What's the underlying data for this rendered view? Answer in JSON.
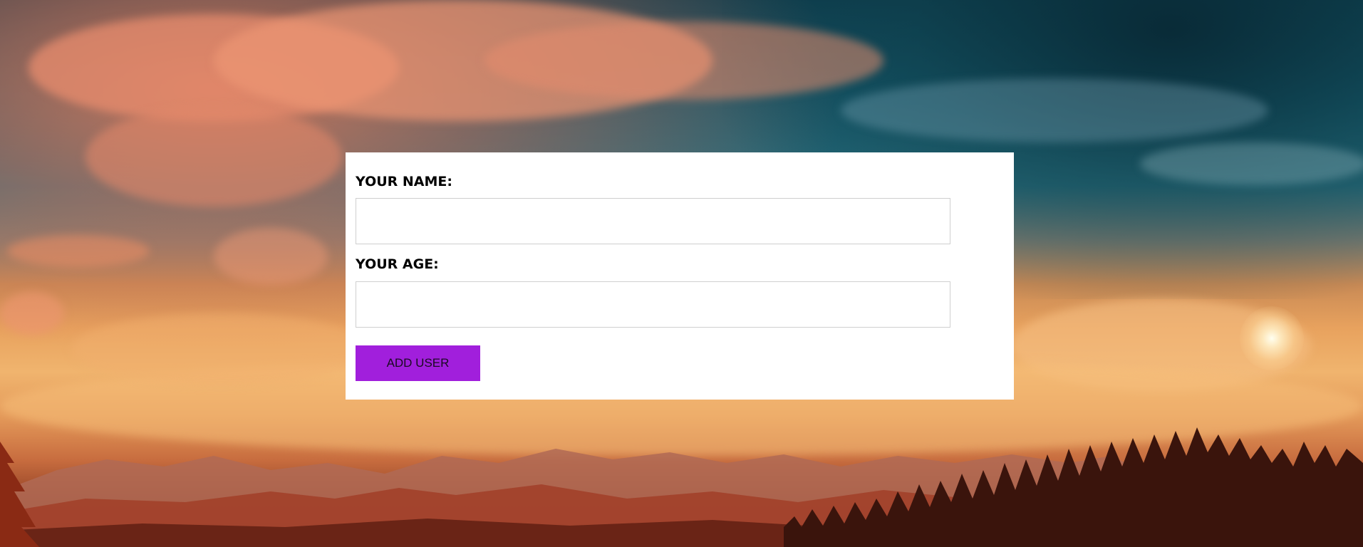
{
  "background": {
    "description_icon": "sunset-landscape-image",
    "colors": {
      "sky_top": "#0f3f4f",
      "clouds_warm": "#e8865e",
      "horizon": "#f0b46e",
      "ground": "#5b1f14"
    }
  },
  "form": {
    "name_label": "YOUR NAME:",
    "name_value": "",
    "name_placeholder": "",
    "age_label": "YOUR AGE:",
    "age_value": "",
    "age_placeholder": "",
    "submit_label": "ADD USER",
    "submit_color": "#a11fdc",
    "panel_color": "#ffffff"
  }
}
